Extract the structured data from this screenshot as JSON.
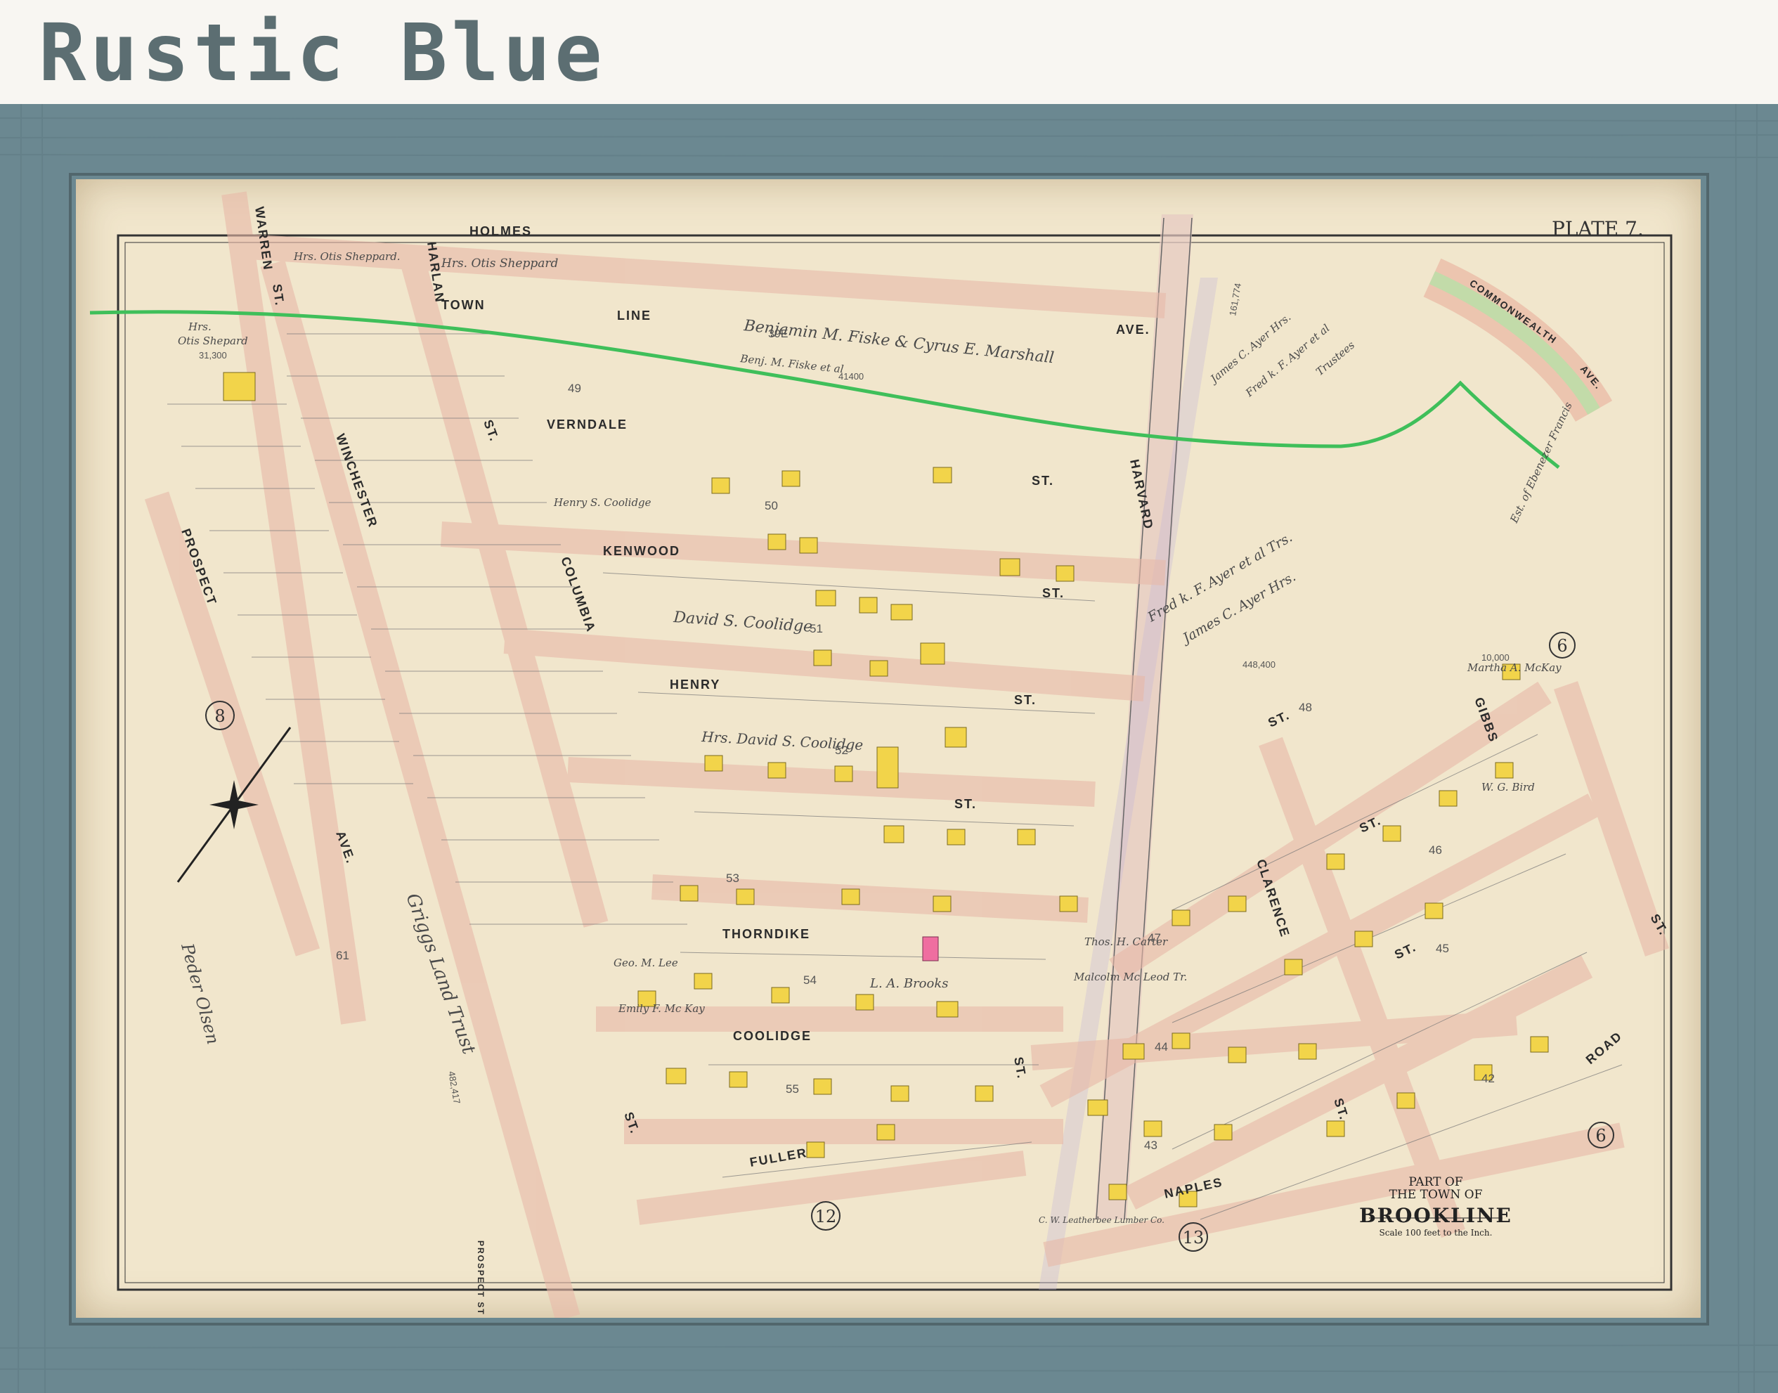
{
  "banner": {
    "title": "Rustic Blue"
  },
  "map": {
    "plate_label": "PLATE 7.",
    "cartouche": {
      "line1": "PART OF",
      "line2": "THE TOWN OF",
      "line3": "BROOKLINE",
      "scale": "Scale 100 feet to the Inch."
    },
    "streets": {
      "holmes": "HOLMES",
      "warren": "WARREN",
      "st": "ST.",
      "harlan": "HARLAN",
      "town_line": "TOWN",
      "line": "LINE",
      "ave": "AVE.",
      "verndale": "VERNDALE",
      "kenwood": "KENWOOD",
      "henry": "HENRY",
      "columbia": "COLUMBIA",
      "winchester": "WINCHESTER",
      "prospect": "PROSPECT",
      "harvard": "HARVARD",
      "commonwealth": "COMMONWEALTH",
      "gibbs": "GIBBS",
      "clarence": "CLARENCE",
      "thorndike": "THORNDIKE",
      "coolidge": "COOLIDGE",
      "fuller": "FULLER",
      "naples": "NAPLES",
      "road": "ROAD",
      "prospect_st": "PROSPECT ST"
    },
    "owners": {
      "otis_sheppard_1": "Hrs. Otis Sheppard.",
      "otis_sheppard_2": "Hrs. Otis Sheppard",
      "otis_shepard_w": "Hrs.",
      "otis_shepard_w2": "Otis Shepard",
      "fiske_marshall": "Benjamin M. Fiske & Cyrus E. Marshall",
      "fiske_etal": "Benj. M. Fiske et al",
      "ayer_1": "James C. Ayer Hrs.",
      "ayer_2": "Fred k. F. Ayer et al",
      "trustees": "Trustees",
      "ayer_3": "Fred k. F. Ayer et al Trs.",
      "ayer_4": "James C. Ayer Hrs.",
      "francis": "Est. of Ebenezer Francis",
      "coolidge_1": "Henry S. Coolidge",
      "coolidge_2": "David S. Coolidge",
      "coolidge_3": "Hrs. David S. Coolidge",
      "griggs": "Griggs Land Trust",
      "peder": "Peder Olsen",
      "mckay": "Martha A. McKay",
      "bird": "W. G. Bird",
      "carter": "Thos. H. Carter",
      "malcolm": "Malcolm Mc Leod Tr.",
      "brooks": "L. A. Brooks",
      "lee": "Geo. M. Lee",
      "mckay2": "Emily F. Mc Kay",
      "leatherbee": "C. W. Leatherbee Lumber Co."
    },
    "areas": {
      "a39e": "39E",
      "a1": "31,300",
      "a2": "41400",
      "a3": "161,774",
      "a4": "448,400",
      "a5": "482,417",
      "a6": "10,000"
    },
    "block_numbers": [
      "49",
      "50",
      "51",
      "52",
      "53",
      "54",
      "55",
      "48",
      "46",
      "47",
      "45",
      "44",
      "43",
      "42",
      "61"
    ],
    "circle_numbers": [
      "8",
      "6",
      "6",
      "12",
      "13"
    ]
  }
}
